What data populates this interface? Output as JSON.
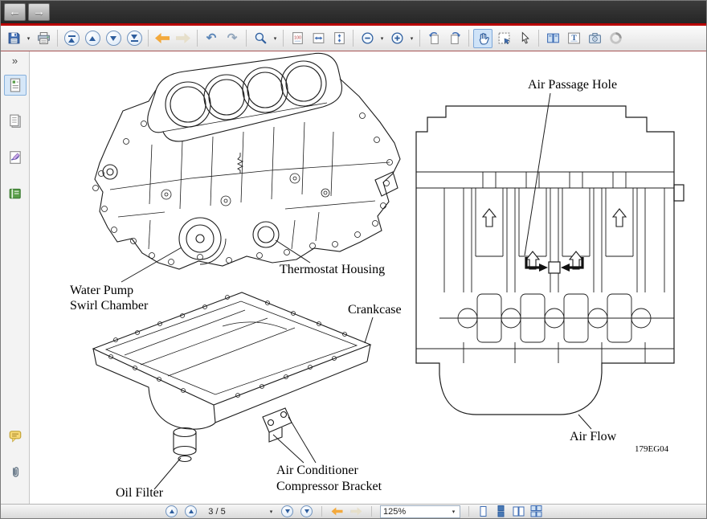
{
  "titlebar": {
    "window_role": "viewer"
  },
  "icons": {
    "back_glyph": "←",
    "forward_glyph": "→",
    "caret_glyph": "▾",
    "undo_glyph": "↶",
    "redo_glyph": "↷",
    "collapse_glyph": "»",
    "text_tool_label": "T"
  },
  "toolbar": {
    "actual_size_label": "100"
  },
  "statusbar": {
    "page_indicator": "3 / 5",
    "zoom_level": "125%"
  },
  "document": {
    "labels": {
      "air_passage_hole": "Air Passage Hole",
      "thermostat_housing": "Thermostat Housing",
      "water_pump_1": "Water Pump",
      "water_pump_2": "Swirl Chamber",
      "crankcase": "Crankcase",
      "oil_filter": "Oil Filter",
      "air_conditioner_1": "Air Conditioner",
      "air_conditioner_2": "Compressor Bracket",
      "air_flow": "Air Flow",
      "figure_code": "179EG04"
    }
  },
  "colors": {
    "accent_red": "#b80000",
    "toolbar_blue": "#2e5e9e",
    "selection_highlight": "#cfe3f8",
    "arrow_yellow": "#f3a93c"
  }
}
